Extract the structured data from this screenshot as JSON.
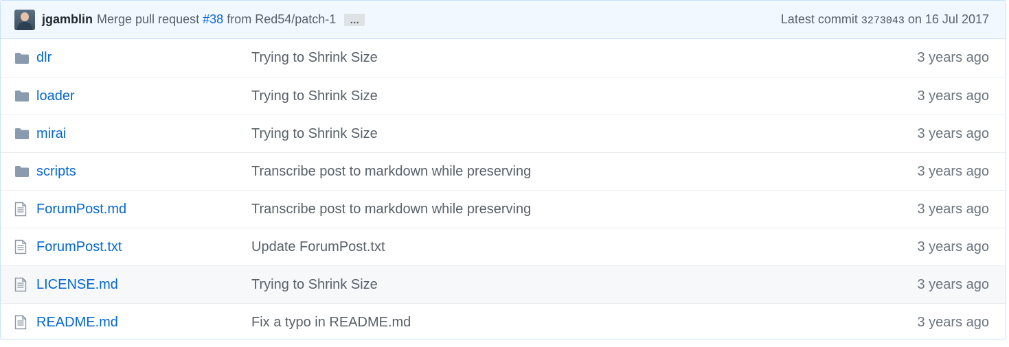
{
  "commit": {
    "author": "jgamblin",
    "message_prefix": "Merge pull request",
    "pr": "#38",
    "message_suffix": "from Red54/patch-1",
    "ellipsis": "…",
    "latest_label": "Latest commit",
    "sha": "3273043",
    "date_text": "on 16 Jul 2017"
  },
  "files": [
    {
      "icon": "folder-icon",
      "name": "dlr",
      "message": "Trying to Shrink Size",
      "age": "3 years ago"
    },
    {
      "icon": "folder-icon",
      "name": "loader",
      "message": "Trying to Shrink Size",
      "age": "3 years ago"
    },
    {
      "icon": "folder-icon",
      "name": "mirai",
      "message": "Trying to Shrink Size",
      "age": "3 years ago"
    },
    {
      "icon": "folder-icon",
      "name": "scripts",
      "message": "Transcribe post to markdown while preserving",
      "age": "3 years ago"
    },
    {
      "icon": "file-icon",
      "name": "ForumPost.md",
      "message": "Transcribe post to markdown while preserving",
      "age": "3 years ago"
    },
    {
      "icon": "file-icon",
      "name": "ForumPost.txt",
      "message": "Update ForumPost.txt",
      "age": "3 years ago"
    },
    {
      "icon": "file-icon",
      "name": "LICENSE.md",
      "message": "Trying to Shrink Size",
      "age": "3 years ago"
    },
    {
      "icon": "file-icon",
      "name": "README.md",
      "message": "Fix a typo in README.md",
      "age": "3 years ago"
    }
  ],
  "colors": {
    "link": "#0366d6",
    "folder": "#79b8ff",
    "commit_bar_bg": "#f1f8ff",
    "hover_row_bg": "#f6f8fa"
  }
}
